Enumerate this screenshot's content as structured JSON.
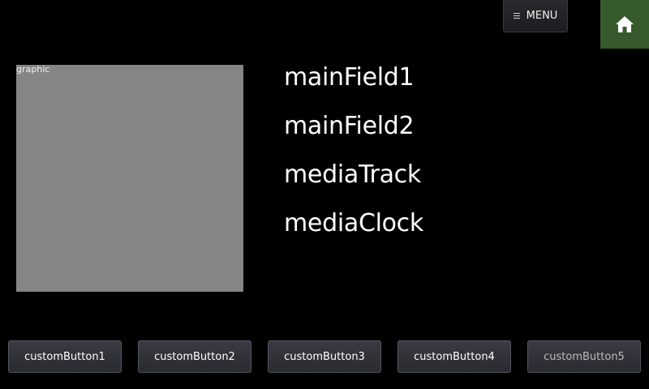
{
  "header": {
    "menu_label": "MENU",
    "menu_icon": "menu-list-icon",
    "home_icon": "home-icon",
    "home_color": "#365a2c"
  },
  "graphic": {
    "label": "graphic",
    "color": "#858585"
  },
  "text_fields": {
    "main_field_1": "mainField1",
    "main_field_2": "mainField2",
    "media_track": "mediaTrack",
    "media_clock": "mediaClock"
  },
  "soft_buttons": [
    {
      "label": "customButton1"
    },
    {
      "label": "customButton2"
    },
    {
      "label": "customButton3"
    },
    {
      "label": "customButton4"
    },
    {
      "label": "customButton5"
    }
  ]
}
